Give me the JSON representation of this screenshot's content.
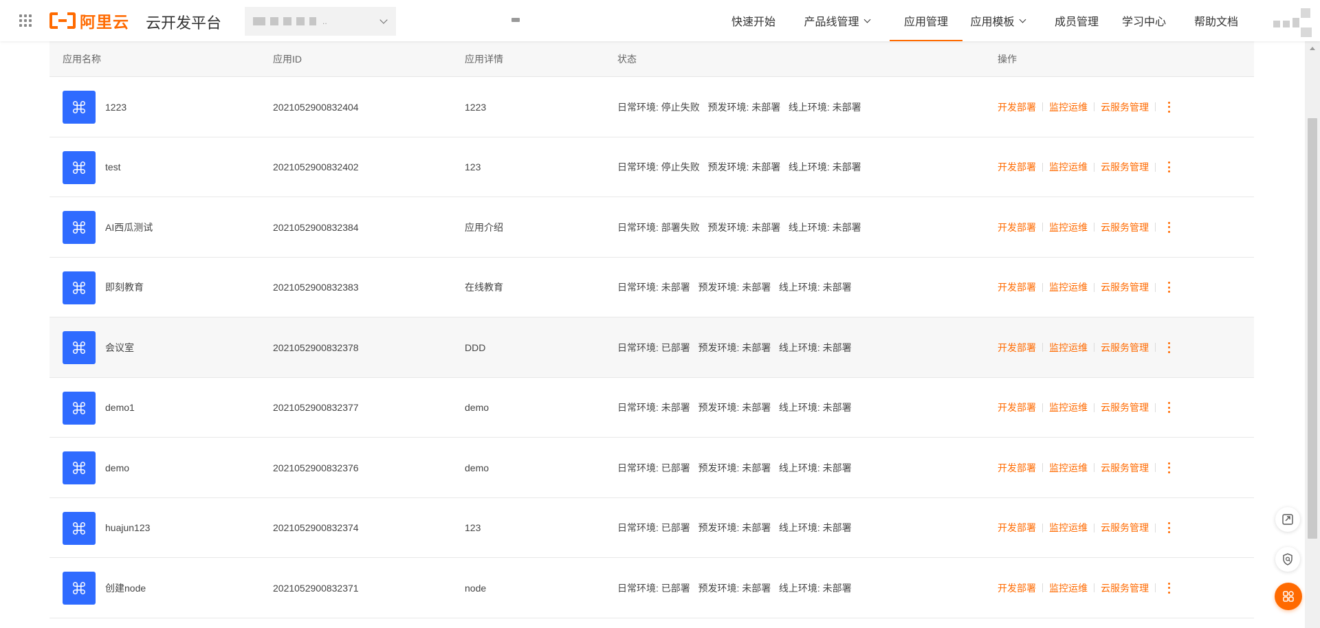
{
  "header": {
    "logo_text": "阿里云",
    "app_title": "云开发平台",
    "nav": [
      {
        "label": "快速开始",
        "has_dropdown": false,
        "active": false
      },
      {
        "label": "产品线管理",
        "has_dropdown": true,
        "active": false
      },
      {
        "label": "应用管理",
        "has_dropdown": false,
        "active": true
      },
      {
        "label": "应用模板",
        "has_dropdown": true,
        "active": false
      },
      {
        "label": "成员管理",
        "has_dropdown": false,
        "active": false
      },
      {
        "label": "学习中心",
        "has_dropdown": false,
        "active": false
      },
      {
        "label": "帮助文档",
        "has_dropdown": false,
        "active": false
      }
    ]
  },
  "table": {
    "columns": {
      "name": "应用名称",
      "id": "应用ID",
      "detail": "应用详情",
      "status": "状态",
      "actions": "操作"
    },
    "actions": {
      "deploy": "开发部署",
      "monitor": "监控运维",
      "cloud_service": "云服务管理"
    },
    "rows": [
      {
        "name": "1223",
        "id": "2021052900832404",
        "detail": "1223",
        "status": "日常环境: 停止失败   预发环境: 未部署   线上环境: 未部署",
        "striped": false
      },
      {
        "name": "test",
        "id": "2021052900832402",
        "detail": "123",
        "status": "日常环境: 停止失败   预发环境: 未部署   线上环境: 未部署",
        "striped": false
      },
      {
        "name": "AI西瓜测试",
        "id": "2021052900832384",
        "detail": "应用介绍",
        "status": "日常环境: 部署失败   预发环境: 未部署   线上环境: 未部署",
        "striped": false
      },
      {
        "name": "即刻教育",
        "id": "2021052900832383",
        "detail": "在线教育",
        "status": "日常环境: 未部署   预发环境: 未部署   线上环境: 未部署",
        "striped": false
      },
      {
        "name": "会议室",
        "id": "2021052900832378",
        "detail": "DDD",
        "status": "日常环境: 已部署   预发环境: 未部署   线上环境: 未部署",
        "striped": true
      },
      {
        "name": "demo1",
        "id": "2021052900832377",
        "detail": "demo",
        "status": "日常环境: 未部署   预发环境: 未部署   线上环境: 未部署",
        "striped": false
      },
      {
        "name": "demo",
        "id": "2021052900832376",
        "detail": "demo",
        "status": "日常环境: 已部署   预发环境: 未部署   线上环境: 未部署",
        "striped": false
      },
      {
        "name": "huajun123",
        "id": "2021052900832374",
        "detail": "123",
        "status": "日常环境: 已部署   预发环境: 未部署   线上环境: 未部署",
        "striped": false
      },
      {
        "name": "创建node",
        "id": "2021052900832371",
        "detail": "node",
        "status": "日常环境: 已部署   预发环境: 未部署   线上环境: 未部署",
        "striped": false
      }
    ]
  },
  "icons": {
    "app_icon": "command-icon",
    "more": "more-vertical-icon",
    "float_1": "send-icon",
    "float_2": "shield-search-icon",
    "float_3": "apps-icon"
  },
  "colors": {
    "brand": "#ff6a00",
    "app_icon_bg": "#2f6bff",
    "header_row_bg": "#f7f7f7"
  }
}
